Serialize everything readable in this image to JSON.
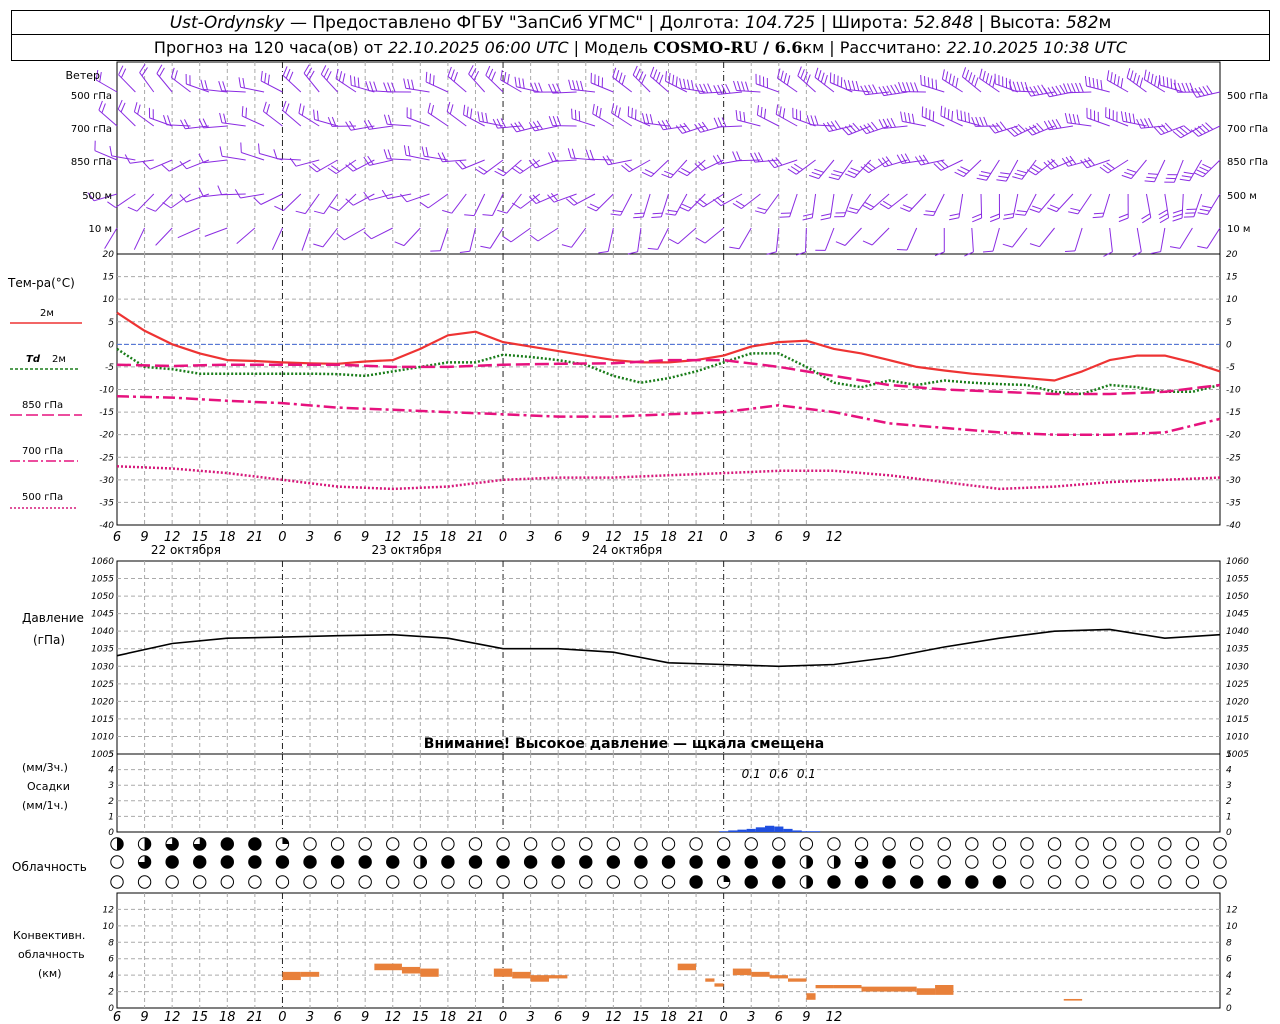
{
  "header": {
    "line1": {
      "station": "Ust-Ordynsky",
      "provider": " — Предоставлено ФГБУ \"ЗапСиб УГМС\" | Долгота: ",
      "lon": "104.725",
      "lat_label": " | Широта: ",
      "lat": "52.848",
      "alt_label": " | Высота: ",
      "alt": "582",
      "alt_unit": "м"
    },
    "line2": {
      "forecast_label": "Прогноз на 120 часа(ов) от ",
      "forecast_from": "22.10.2025 06:00 UTC",
      "model_label": "  | Модель ",
      "model": "COSMO-RU / 6.6",
      "model_unit": "км",
      "calc_label": " | Рассчитано: ",
      "calc": "22.10.2025 10:38 UTC"
    }
  },
  "time_axis": {
    "hour_labels": [
      "6",
      "9",
      "12",
      "15",
      "18",
      "21",
      "0",
      "3",
      "6",
      "9",
      "12",
      "15",
      "18",
      "21",
      "0",
      "3",
      "6",
      "9",
      "12",
      "15",
      "18",
      "21",
      "0",
      "3",
      "6",
      "9",
      "12"
    ],
    "midnight_indices": [
      6,
      14,
      22
    ],
    "day_labels": [
      {
        "text": "22 октября",
        "hour_index": 2.5
      },
      {
        "text": "23 октября",
        "hour_index": 10.5
      },
      {
        "text": "24 октября",
        "hour_index": 18.5
      }
    ]
  },
  "wind_panel": {
    "title": "Ветер",
    "levels": [
      "500 гПа",
      "700 гПа",
      "850 гПа",
      "500 м",
      "10  м"
    ],
    "barb_color": "#8a2be2"
  },
  "chart_data": [
    {
      "type": "line",
      "title": "Тем-ра(°С)",
      "x_unit": "hours since 22.10.2025 06:00 UTC",
      "ylim": [
        -40,
        20
      ],
      "yticks": [
        20,
        15,
        10,
        5,
        0,
        -5,
        -10,
        -15,
        -20,
        -25,
        -30,
        -35,
        -40
      ],
      "zero_line_color": "#4a6fd8",
      "series": [
        {
          "name": "2м",
          "color": "#ee3333",
          "style": "solid",
          "x": [
            0,
            3,
            6,
            9,
            12,
            15,
            18,
            21,
            24,
            27,
            30,
            33,
            36,
            39,
            42,
            45,
            48,
            51,
            54,
            57,
            60,
            63,
            66,
            69,
            72,
            75,
            78,
            81,
            84,
            87,
            90,
            93,
            96,
            99,
            102,
            105,
            108,
            111,
            114,
            117,
            120
          ],
          "y": [
            7,
            3,
            0,
            -2,
            -3.5,
            -3.7,
            -4,
            -4.2,
            -4.3,
            -3.8,
            -3.5,
            -1,
            2,
            2.8,
            0.5,
            -0.5,
            -1.5,
            -2.5,
            -3.5,
            -4,
            -4,
            -3.5,
            -2.5,
            -0.5,
            0.5,
            0.8,
            -1,
            -2,
            -3.5,
            -5,
            -5.8,
            -6.5,
            -7,
            -7.5,
            -8,
            -6,
            -3.5,
            -2.5,
            -2.5,
            -4,
            -6
          ]
        },
        {
          "name": "Td  2м",
          "color": "#1a7d1a",
          "style": "dotted",
          "x": [
            0,
            3,
            6,
            9,
            12,
            15,
            18,
            21,
            24,
            27,
            30,
            33,
            36,
            39,
            42,
            45,
            48,
            51,
            54,
            57,
            60,
            63,
            66,
            69,
            72,
            75,
            78,
            81,
            84,
            87,
            90,
            93,
            96,
            99,
            102,
            105,
            108,
            111,
            114,
            117,
            120
          ],
          "y": [
            -1,
            -5,
            -5.5,
            -6.5,
            -6.5,
            -6.5,
            -6.5,
            -6.5,
            -6.6,
            -7,
            -6,
            -5,
            -4,
            -4,
            -2.3,
            -2.8,
            -3.5,
            -4.5,
            -7,
            -8.5,
            -7.5,
            -6,
            -4,
            -2,
            -2,
            -5,
            -8.5,
            -9.5,
            -8,
            -9,
            -8,
            -8.5,
            -8.8,
            -9,
            -10.5,
            -11,
            -9,
            -9.5,
            -10.5,
            -10.5,
            -9
          ]
        },
        {
          "name": "850 гПа",
          "color": "#e6127e",
          "style": "longdash",
          "x": [
            0,
            6,
            12,
            18,
            24,
            30,
            36,
            42,
            48,
            54,
            60,
            66,
            72,
            78,
            84,
            90,
            96,
            102,
            108,
            114,
            120
          ],
          "y": [
            -4.5,
            -4.8,
            -4.5,
            -4.5,
            -4.5,
            -5,
            -5,
            -4.5,
            -4.3,
            -4.2,
            -3.5,
            -3.5,
            -5,
            -7,
            -9,
            -10,
            -10.5,
            -11,
            -11,
            -10.5,
            -9
          ]
        },
        {
          "name": "700 гПа",
          "color": "#e6127e",
          "style": "dashdot",
          "x": [
            0,
            6,
            12,
            18,
            24,
            30,
            36,
            42,
            48,
            54,
            60,
            66,
            72,
            78,
            84,
            90,
            96,
            102,
            108,
            114,
            120
          ],
          "y": [
            -11.5,
            -11.8,
            -12.5,
            -13,
            -14,
            -14.5,
            -15,
            -15.5,
            -16,
            -16,
            -15.5,
            -15,
            -13.5,
            -15,
            -17.5,
            -18.5,
            -19.5,
            -20,
            -20,
            -19.5,
            -16.5
          ]
        },
        {
          "name": "500 гПа",
          "color": "#d6187a",
          "style": "dotted",
          "x": [
            0,
            6,
            12,
            18,
            24,
            30,
            36,
            42,
            48,
            54,
            60,
            66,
            72,
            78,
            84,
            90,
            96,
            102,
            108,
            114,
            120
          ],
          "y": [
            -27,
            -27.5,
            -28.5,
            -30,
            -31.5,
            -32,
            -31.5,
            -30,
            -29.5,
            -29.5,
            -29,
            -28.5,
            -28,
            -28,
            -29,
            -30.5,
            -32,
            -31.5,
            -30.5,
            -30,
            -29.5
          ]
        }
      ]
    },
    {
      "type": "line",
      "title": "Давление",
      "unit": "(гПа)",
      "ylim": [
        1005,
        1060
      ],
      "yticks": [
        1060,
        1055,
        1050,
        1045,
        1040,
        1035,
        1030,
        1025,
        1020,
        1015,
        1010,
        1005
      ],
      "annotation": "Внимание! Высокое давление — шкала смещена",
      "series": [
        {
          "color": "#000000",
          "x": [
            0,
            6,
            12,
            18,
            24,
            30,
            36,
            42,
            48,
            54,
            60,
            66,
            72,
            78,
            84,
            90,
            96,
            102,
            108,
            114,
            120
          ],
          "y": [
            1033,
            1036.5,
            1038,
            1038.3,
            1038.7,
            1039,
            1038,
            1035,
            1035,
            1034,
            1031,
            1030.5,
            1030,
            1030.5,
            1032.5,
            1035.5,
            1038,
            1040,
            1040.5,
            1038,
            1039
          ]
        }
      ]
    },
    {
      "type": "bar",
      "title": "Осадки",
      "units": [
        "(мм/3ч.)",
        "(мм/1ч.)"
      ],
      "ylim": [
        0,
        5
      ],
      "yticks": [
        5,
        4,
        3,
        2,
        1,
        0
      ],
      "value_labels": [
        {
          "text": "0.1",
          "hour": 69
        },
        {
          "text": "0.6",
          "hour": 72
        },
        {
          "text": "0.1",
          "hour": 75
        }
      ],
      "bars": [
        {
          "hour": 66,
          "value": 0.05
        },
        {
          "hour": 67,
          "value": 0.1
        },
        {
          "hour": 68,
          "value": 0.15
        },
        {
          "hour": 69,
          "value": 0.2
        },
        {
          "hour": 70,
          "value": 0.3
        },
        {
          "hour": 71,
          "value": 0.4
        },
        {
          "hour": 72,
          "value": 0.35
        },
        {
          "hour": 73,
          "value": 0.2
        },
        {
          "hour": 74,
          "value": 0.1
        },
        {
          "hour": 75,
          "value": 0.05
        },
        {
          "hour": 76,
          "value": 0.05
        }
      ],
      "bar_color": "#1f4fe0"
    },
    {
      "type": "table",
      "title": "Облачность",
      "levels": [
        "upper",
        "middle",
        "lower"
      ],
      "hours": [
        0,
        3,
        6,
        9,
        12,
        15,
        18,
        21,
        24,
        27,
        30,
        33,
        36,
        39,
        42,
        45,
        48,
        51,
        54,
        57,
        60,
        63,
        66,
        69,
        72,
        75,
        78,
        81,
        84,
        87,
        90,
        93,
        96,
        99,
        102,
        105,
        108,
        111,
        114,
        117,
        120
      ],
      "upper_fraction": [
        0.5,
        0.5,
        0.75,
        0.75,
        1,
        1,
        0.25,
        0,
        0,
        0,
        0,
        0,
        0,
        0,
        0,
        0,
        0,
        0,
        0,
        0,
        0,
        0,
        0,
        0,
        0,
        0,
        0,
        0,
        0,
        0,
        0,
        0,
        0,
        0,
        0,
        0,
        0,
        0,
        0,
        0,
        0
      ],
      "middle_fraction": [
        0,
        0.75,
        1,
        1,
        1,
        1,
        1,
        1,
        1,
        1,
        1,
        0.5,
        1,
        1,
        1,
        1,
        1,
        1,
        1,
        1,
        1,
        1,
        1,
        1,
        1,
        0.5,
        0.5,
        0.75,
        1,
        0,
        0,
        0,
        0,
        0,
        0,
        0,
        0,
        0,
        0,
        0,
        0
      ],
      "lower_fraction": [
        0,
        0,
        0,
        0,
        0,
        0,
        0,
        0,
        0,
        0,
        0,
        0,
        0,
        0,
        0,
        0,
        0,
        0,
        0,
        0,
        0,
        1,
        0.25,
        1,
        1,
        0.5,
        1,
        1,
        1,
        1,
        1,
        1,
        1,
        0,
        0,
        0,
        0,
        0,
        0,
        0,
        0
      ]
    },
    {
      "type": "bar",
      "title": "Конвективн. облачность",
      "unit": "(км)",
      "ylim": [
        0,
        14
      ],
      "yticks": [
        12,
        10,
        8,
        6,
        4,
        2,
        0
      ],
      "bar_color": "#e8803a",
      "segments": [
        {
          "h0": 18,
          "h1": 20,
          "base": 3.4,
          "top": 4.4
        },
        {
          "h0": 20,
          "h1": 22,
          "base": 3.8,
          "top": 4.4
        },
        {
          "h0": 28,
          "h1": 31,
          "base": 4.6,
          "top": 5.4
        },
        {
          "h0": 31,
          "h1": 33,
          "base": 4.2,
          "top": 5.0
        },
        {
          "h0": 33,
          "h1": 35,
          "base": 3.8,
          "top": 4.8
        },
        {
          "h0": 41,
          "h1": 43,
          "base": 3.8,
          "top": 4.8
        },
        {
          "h0": 43,
          "h1": 45,
          "base": 3.6,
          "top": 4.4
        },
        {
          "h0": 45,
          "h1": 47,
          "base": 3.2,
          "top": 4.0
        },
        {
          "h0": 47,
          "h1": 49,
          "base": 3.6,
          "top": 4.0
        },
        {
          "h0": 61,
          "h1": 63,
          "base": 4.6,
          "top": 5.4
        },
        {
          "h0": 64,
          "h1": 65,
          "base": 3.2,
          "top": 3.6
        },
        {
          "h0": 65,
          "h1": 66,
          "base": 2.6,
          "top": 3.0
        },
        {
          "h0": 67,
          "h1": 69,
          "base": 4.0,
          "top": 4.8
        },
        {
          "h0": 69,
          "h1": 71,
          "base": 3.8,
          "top": 4.4
        },
        {
          "h0": 71,
          "h1": 73,
          "base": 3.6,
          "top": 4.0
        },
        {
          "h0": 73,
          "h1": 75,
          "base": 3.2,
          "top": 3.6
        },
        {
          "h0": 75,
          "h1": 76,
          "base": 1.0,
          "top": 1.8
        },
        {
          "h0": 76,
          "h1": 78,
          "base": 2.4,
          "top": 2.8
        },
        {
          "h0": 78,
          "h1": 81,
          "base": 2.4,
          "top": 2.8
        },
        {
          "h0": 81,
          "h1": 87,
          "base": 2.0,
          "top": 2.6
        },
        {
          "h0": 87,
          "h1": 89,
          "base": 1.6,
          "top": 2.4
        },
        {
          "h0": 89,
          "h1": 91,
          "base": 1.6,
          "top": 2.8
        },
        {
          "h0": 103,
          "h1": 105,
          "base": 0.9,
          "top": 1.1
        }
      ]
    }
  ],
  "legend": {
    "temp_title": "Тем-ра(°С)",
    "items": [
      "2м",
      "Td",
      "2м",
      "850 гПа",
      "700 гПа",
      "500 гПа"
    ]
  },
  "labels": {
    "pressure_title": "Давление",
    "pressure_unit": "(гПа)",
    "pressure_warning": "Внимание! Высокое давление — щкала смещена",
    "precip_unit3": "(мм/3ч.)",
    "precip_title": "Осадки",
    "precip_unit1": "(мм/1ч.)",
    "cloud_title": "Облачность",
    "conv_title1": "Конвективн.",
    "conv_title2": "облачность",
    "conv_unit": "(км)"
  }
}
